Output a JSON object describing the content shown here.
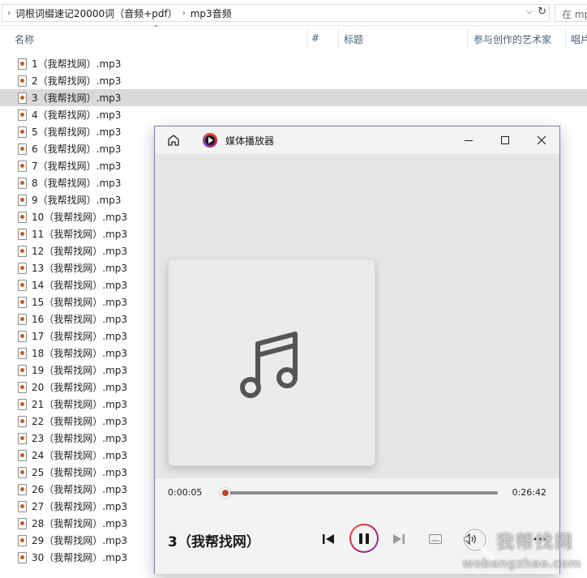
{
  "address": {
    "crumbs": [
      "词根词缀速记20000词（音频+pdf）",
      "mp3音频"
    ],
    "search_placeholder": "在 mp"
  },
  "columns": {
    "name": "名称",
    "number": "#",
    "title": "标题",
    "artists": "参与创作的艺术家",
    "album": "唱片"
  },
  "files": [
    {
      "name": "1（我帮找网）.mp3",
      "selected": false
    },
    {
      "name": "2（我帮找网）.mp3",
      "selected": false
    },
    {
      "name": "3（我帮找网）.mp3",
      "selected": true
    },
    {
      "name": "4（我帮找网）.mp3",
      "selected": false
    },
    {
      "name": "5（我帮找网）.mp3",
      "selected": false
    },
    {
      "name": "6（我帮找网）.mp3",
      "selected": false
    },
    {
      "name": "7（我帮找网）.mp3",
      "selected": false
    },
    {
      "name": "8（我帮找网）.mp3",
      "selected": false
    },
    {
      "name": "9（我帮找网）.mp3",
      "selected": false
    },
    {
      "name": "10（我帮找网）.mp3",
      "selected": false
    },
    {
      "name": "11（我帮找网）.mp3",
      "selected": false
    },
    {
      "name": "12（我帮找网）.mp3",
      "selected": false
    },
    {
      "name": "13（我帮找网）.mp3",
      "selected": false
    },
    {
      "name": "14（我帮找网）.mp3",
      "selected": false
    },
    {
      "name": "15（我帮找网）.mp3",
      "selected": false
    },
    {
      "name": "16（我帮找网）.mp3",
      "selected": false
    },
    {
      "name": "17（我帮找网）.mp3",
      "selected": false
    },
    {
      "name": "18（我帮找网）.mp3",
      "selected": false
    },
    {
      "name": "19（我帮找网）.mp3",
      "selected": false
    },
    {
      "name": "20（我帮找网）.mp3",
      "selected": false
    },
    {
      "name": "21（我帮找网）.mp3",
      "selected": false
    },
    {
      "name": "22（我帮找网）.mp3",
      "selected": false
    },
    {
      "name": "23（我帮找网）.mp3",
      "selected": false
    },
    {
      "name": "24（我帮找网）.mp3",
      "selected": false
    },
    {
      "name": "25（我帮找网）.mp3",
      "selected": false
    },
    {
      "name": "26（我帮找网）.mp3",
      "selected": false
    },
    {
      "name": "27（我帮找网）.mp3",
      "selected": false
    },
    {
      "name": "28（我帮找网）.mp3",
      "selected": false
    },
    {
      "name": "29（我帮找网）.mp3",
      "selected": false
    },
    {
      "name": "30（我帮找网）.mp3",
      "selected": false
    }
  ],
  "player": {
    "app_name": "媒体播放器",
    "current_time": "0:00:05",
    "total_time": "0:26:42",
    "progress_fraction": 0.003,
    "track_title": "3（我帮找网）",
    "icons": [
      "home-icon",
      "app-icon",
      "minimize-icon",
      "maximize-icon",
      "close-icon",
      "music-note-icon",
      "previous-icon",
      "pause-icon",
      "next-icon",
      "miniplayer-icon",
      "volume-icon",
      "more-icon"
    ],
    "accent": "#c4462a"
  },
  "watermark": {
    "text": "我帮找网",
    "url": "wobangzhao.com"
  }
}
